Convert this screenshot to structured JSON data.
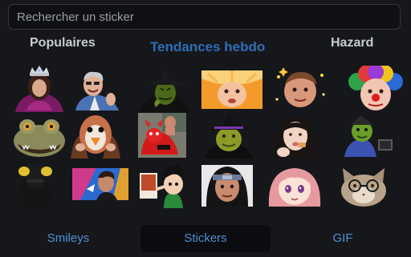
{
  "search": {
    "placeholder": "Rechercher un sticker"
  },
  "tabs": [
    {
      "label": "Populaires"
    },
    {
      "label": "Tendances hebdo"
    },
    {
      "label": "Hazard"
    }
  ],
  "stickers": [
    {
      "name": "sticker-queen",
      "icon": "crowned-woman-sticker"
    },
    {
      "name": "sticker-gray-hair-man",
      "icon": "laughing-man-sticker"
    },
    {
      "name": "sticker-witch-hat",
      "icon": "green-witch-sticker"
    },
    {
      "name": "sticker-orange-face",
      "icon": "orange-slice-face-sticker"
    },
    {
      "name": "sticker-sparkle-face",
      "icon": "sparkle-face-sticker"
    },
    {
      "name": "sticker-clown",
      "icon": "clown-sticker"
    },
    {
      "name": "sticker-frog-monster",
      "icon": "frog-creature-sticker"
    },
    {
      "name": "sticker-bird-face",
      "icon": "bird-face-sticker"
    },
    {
      "name": "sticker-red-dog",
      "icon": "red-dog-meme-sticker"
    },
    {
      "name": "sticker-shrek-witch",
      "icon": "green-ogre-witch-sticker"
    },
    {
      "name": "sticker-girl-eating",
      "icon": "girl-eating-sticker"
    },
    {
      "name": "sticker-green-goblin",
      "icon": "green-goblin-sticker"
    },
    {
      "name": "sticker-dark-figure",
      "icon": "dark-figure-sticker"
    },
    {
      "name": "sticker-blue-man",
      "icon": "blue-background-man-sticker"
    },
    {
      "name": "sticker-cartoon-pointing",
      "icon": "cartoon-pointing-sticker"
    },
    {
      "name": "sticker-itachi-man",
      "icon": "anime-headband-man-sticker"
    },
    {
      "name": "sticker-anime-girl",
      "icon": "pink-anime-girl-sticker"
    },
    {
      "name": "sticker-glasses-cat",
      "icon": "glasses-cat-sticker"
    }
  ],
  "bottom_tabs": [
    {
      "label": "Smileys"
    },
    {
      "label": "Stickers"
    },
    {
      "label": "GIF"
    }
  ]
}
